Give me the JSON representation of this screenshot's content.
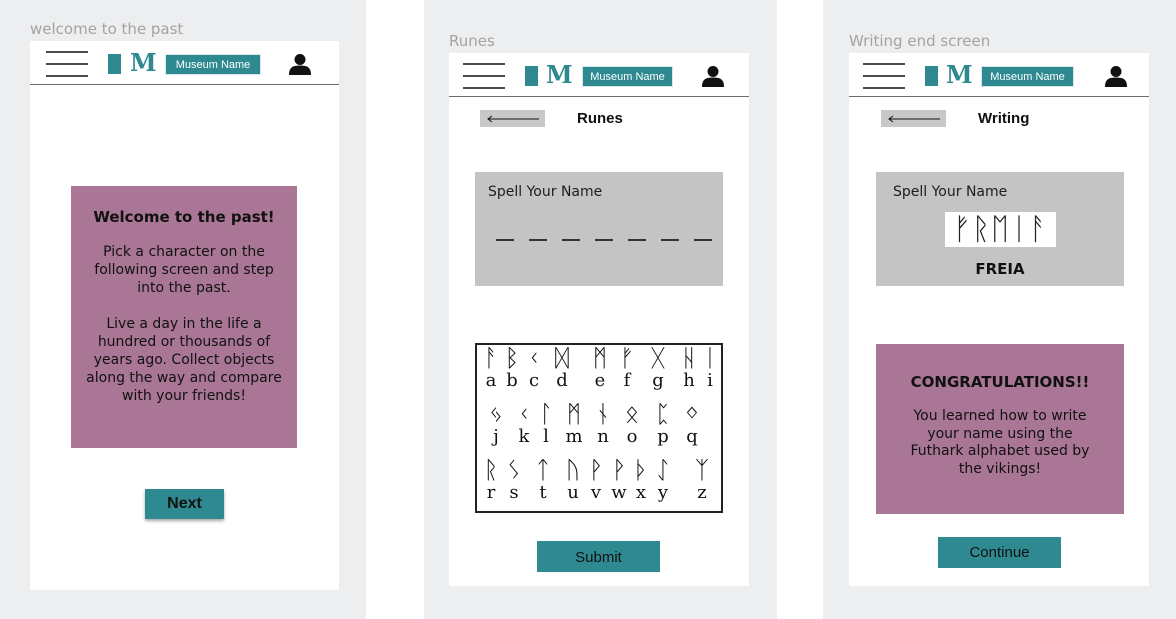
{
  "frames": {
    "welcome": {
      "label": "welcome to the past"
    },
    "runes": {
      "label": "Runes"
    },
    "writing_end": {
      "label": "Writing end screen"
    }
  },
  "header": {
    "logo_letter": "M",
    "museum_name": "Museum Name",
    "icons": {
      "menu": "hamburger-icon",
      "user": "user-icon",
      "back": "back-arrow-icon"
    }
  },
  "welcome": {
    "title": "Welcome to the past!",
    "paragraph1": "Pick a character on the following screen and step into the past.",
    "paragraph2": "Live a day in the life a hundred or thousands of years ago. Collect objects along the way and compare with your friends!",
    "next_label": "Next"
  },
  "runes": {
    "title": "Runes",
    "spell_label": "Spell Your Name",
    "chart_rows": [
      [
        {
          "rune": "ᚨ",
          "letter": "a"
        },
        {
          "rune": "ᛒ",
          "letter": "b"
        },
        {
          "rune": "ᚲ",
          "letter": "c"
        },
        {
          "rune": "ᛞ",
          "letter": "d"
        },
        {
          "rune": "ᛗ",
          "letter": "e"
        },
        {
          "rune": "ᚠ",
          "letter": "f"
        },
        {
          "rune": "ᚷ",
          "letter": "g"
        },
        {
          "rune": "ᚺ",
          "letter": "h"
        },
        {
          "rune": "ᛁ",
          "letter": "i"
        }
      ],
      [
        {
          "rune": "ᛃ",
          "letter": "j"
        },
        {
          "rune": "ᚲ",
          "letter": "k"
        },
        {
          "rune": "ᛚ",
          "letter": "l"
        },
        {
          "rune": "ᛗ",
          "letter": "m"
        },
        {
          "rune": "ᚾ",
          "letter": "n"
        },
        {
          "rune": "ᛟ",
          "letter": "o"
        },
        {
          "rune": "ᛈ",
          "letter": "p"
        },
        {
          "rune": "ᛜ",
          "letter": "q"
        }
      ],
      [
        {
          "rune": "ᚱ",
          "letter": "r"
        },
        {
          "rune": "ᛊ",
          "letter": "s"
        },
        {
          "rune": "ᛏ",
          "letter": "t"
        },
        {
          "rune": "ᚢ",
          "letter": "u"
        },
        {
          "rune": "ᚹ",
          "letter": "v"
        },
        {
          "rune": "ᚹ",
          "letter": "w"
        },
        {
          "rune": "ᚦ",
          "letter": "x"
        },
        {
          "rune": "ᛇ",
          "letter": "y"
        },
        {
          "rune": "ᛉ",
          "letter": "z"
        }
      ]
    ],
    "submit_label": "Submit"
  },
  "writing": {
    "title": "Writing",
    "spell_label": "Spell Your Name",
    "name_runes": "ᚠᚱᛖᛁᚨ",
    "name": "FREIA",
    "congrats_title": "CONGRATULATIONS!!",
    "congrats_body": "You learned how to write your name using the Futhark alphabet used by the vikings!",
    "continue_label": "Continue"
  },
  "colors": {
    "teal": "#2e8a90",
    "mauve": "#aa7695",
    "grey_box": "#c4c4c4",
    "canvas": "#eceef0"
  }
}
